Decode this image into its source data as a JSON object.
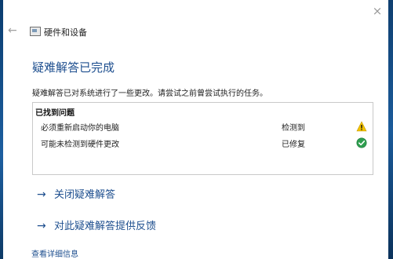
{
  "window": {
    "close_glyph": "×",
    "back_glyph": "←",
    "app_title": "硬件和设备"
  },
  "main": {
    "heading": "疑难解答已完成",
    "description": "疑难解答已对系统进行了一些更改。请尝试之前曾尝试执行的任务。",
    "problems_header": "已找到问题",
    "problems": [
      {
        "label": "必须重新启动你的电脑",
        "status": "检测到",
        "icon": "warning-icon"
      },
      {
        "label": "可能未检测到硬件更改",
        "status": "已修复",
        "icon": "check-icon"
      }
    ],
    "links": [
      {
        "arrow": "→",
        "label": "关闭疑难解答"
      },
      {
        "arrow": "→",
        "label": "对此疑难解答提供反馈"
      }
    ],
    "details_link": "查看详细信息"
  },
  "colors": {
    "accent": "#1e4f8f",
    "warning": "#f2c200",
    "success": "#2e9e4f"
  }
}
